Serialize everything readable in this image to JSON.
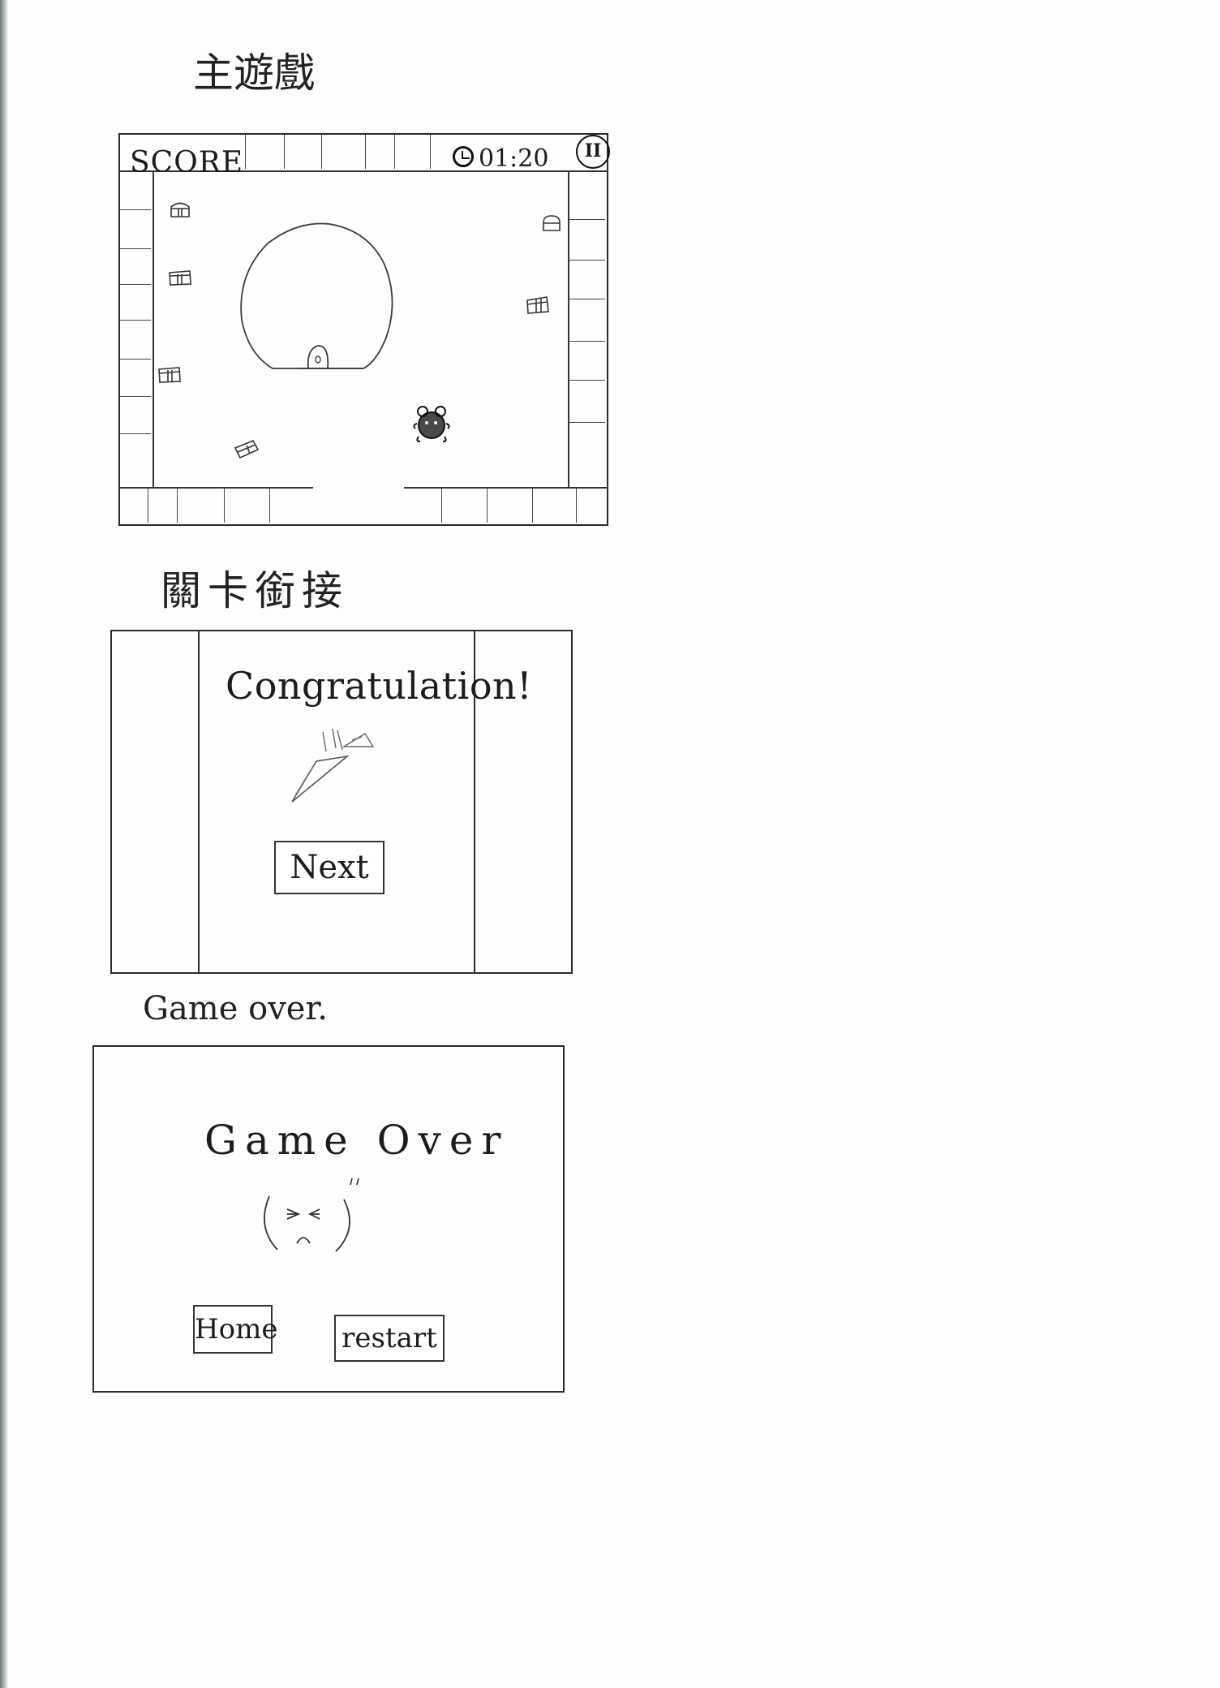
{
  "sections": {
    "main_game": {
      "heading": "主遊戲"
    },
    "level_transition": {
      "heading": "關卡銜接"
    },
    "game_over": {
      "heading": "Game over."
    }
  },
  "main_game": {
    "score_label": "SCORE",
    "timer": "01:20",
    "pause_label": "II",
    "icons": [
      "clock-icon",
      "pause-icon",
      "treasure-chest-icon",
      "player-character-icon"
    ]
  },
  "level_transition": {
    "message": "Congratulation!",
    "next_label": "Next",
    "icon": "party-popper-icon"
  },
  "game_over": {
    "title": "Game Over",
    "home_label": "Home",
    "restart_label": "restart",
    "icon": "sad-face-icon"
  }
}
